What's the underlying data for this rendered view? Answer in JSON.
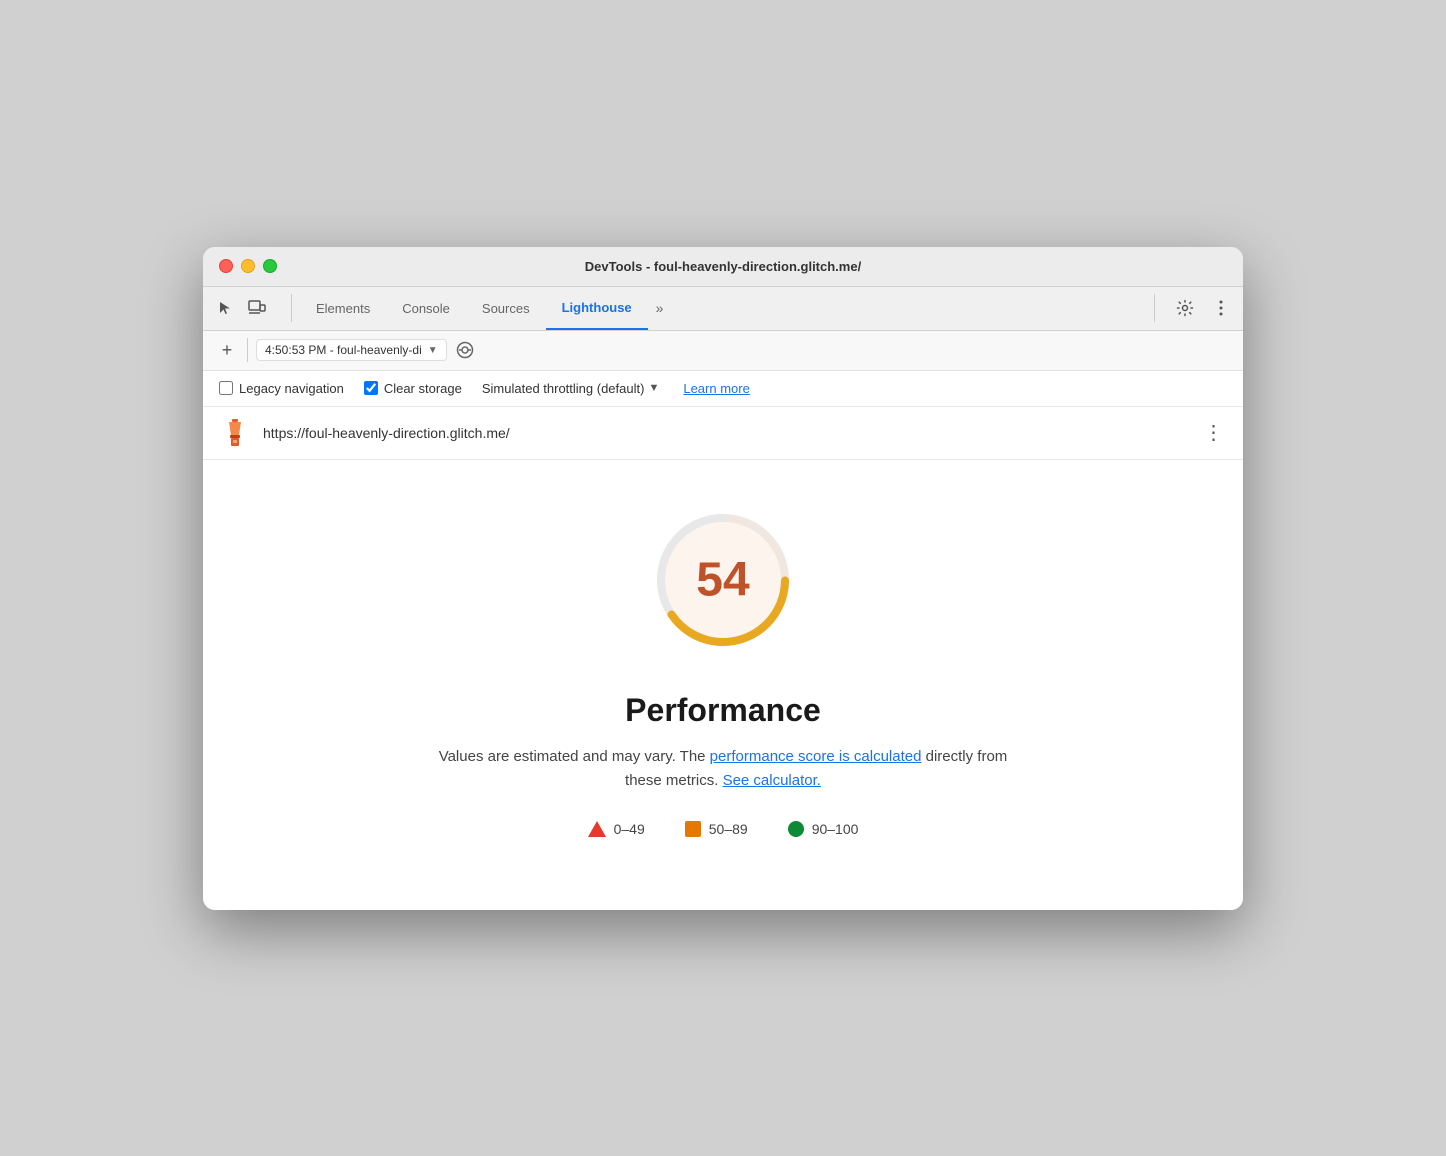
{
  "window": {
    "title": "DevTools - foul-heavenly-direction.glitch.me/"
  },
  "tabs": {
    "items": [
      {
        "id": "elements",
        "label": "Elements",
        "active": false
      },
      {
        "id": "console",
        "label": "Console",
        "active": false
      },
      {
        "id": "sources",
        "label": "Sources",
        "active": false
      },
      {
        "id": "lighthouse",
        "label": "Lighthouse",
        "active": true
      }
    ],
    "overflow_label": "»"
  },
  "secondary_toolbar": {
    "timestamp": "4:50:53 PM - foul-heavenly-di",
    "add_label": "+"
  },
  "options": {
    "legacy_nav_label": "Legacy navigation",
    "legacy_nav_checked": false,
    "clear_storage_label": "Clear storage",
    "clear_storage_checked": true,
    "throttling_label": "Simulated throttling (default)",
    "learn_more_label": "Learn more"
  },
  "url_bar": {
    "url": "https://foul-heavenly-direction.glitch.me/"
  },
  "score": {
    "value": "54",
    "color": "#c0522a",
    "bg_color": "#fdf4ee"
  },
  "performance": {
    "title": "Performance",
    "desc_static": "Values are estimated and may vary. The ",
    "desc_link1": "performance score is calculated",
    "desc_mid": " directly from these metrics. ",
    "desc_link2": "See calculator."
  },
  "legend": {
    "items": [
      {
        "range": "0–49",
        "color": "red"
      },
      {
        "range": "50–89",
        "color": "orange"
      },
      {
        "range": "90–100",
        "color": "green"
      }
    ]
  }
}
